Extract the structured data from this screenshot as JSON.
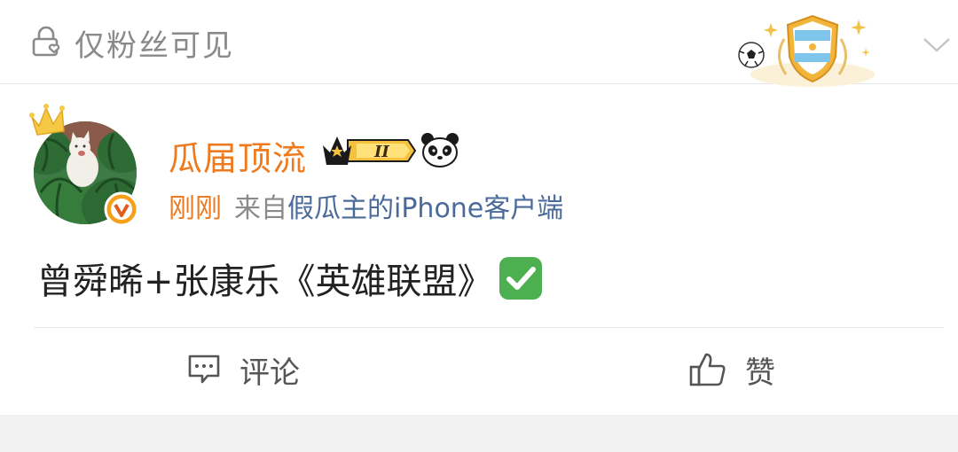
{
  "visibility": {
    "label": "仅粉丝可见"
  },
  "author": {
    "name": "瓜届顶流",
    "vip_level": "II"
  },
  "meta": {
    "time": "刚刚",
    "from_prefix": "来自",
    "source": "假瓜主的iPhone客户端"
  },
  "post": {
    "text": "曾舜晞+张康乐《英雄联盟》"
  },
  "actions": {
    "comment_label": "评论",
    "like_label": "赞"
  },
  "colors": {
    "accent_orange": "#ee7a1f",
    "source_blue": "#4a6b9a",
    "muted_gray": "#8a8a8a",
    "check_green": "#4caf50"
  },
  "icons": {
    "lock": "lock-heart-icon",
    "badge": "argentina-shield-badge-icon",
    "soccer": "soccer-ball-icon",
    "expand": "chevron-down-icon",
    "crown": "crown-icon",
    "verified": "verified-v-icon",
    "vip": "vip-crown-badge-icon",
    "panda": "panda-icon",
    "check": "check-mark-emoji-icon",
    "comment": "comment-icon",
    "like": "thumbs-up-icon"
  }
}
